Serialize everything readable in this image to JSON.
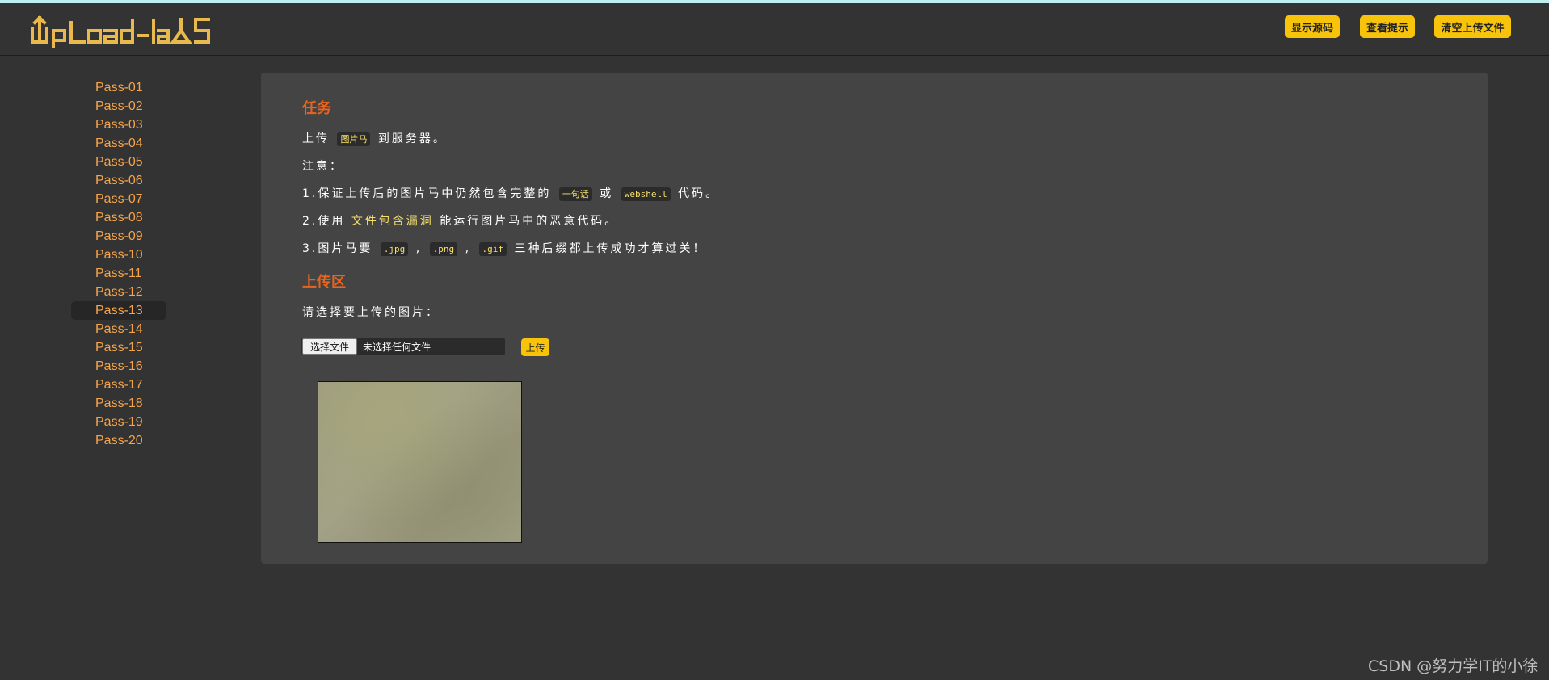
{
  "header": {
    "logo_text": "UpLoad-labS",
    "buttons": [
      "显示源码",
      "查看提示",
      "清空上传文件"
    ]
  },
  "sidebar": {
    "items": [
      "Pass-01",
      "Pass-02",
      "Pass-03",
      "Pass-04",
      "Pass-05",
      "Pass-06",
      "Pass-07",
      "Pass-08",
      "Pass-09",
      "Pass-10",
      "Pass-11",
      "Pass-12",
      "Pass-13",
      "Pass-14",
      "Pass-15",
      "Pass-16",
      "Pass-17",
      "Pass-18",
      "Pass-19",
      "Pass-20"
    ],
    "active": "Pass-13"
  },
  "task": {
    "title": "任务",
    "line1_pre": "上传",
    "line1_code": "图片马",
    "line1_post": "到服务器。",
    "note": "注意：",
    "item1_pre": "1.保证上传后的图片马中仍然包含完整的",
    "item1_code1": "一句话",
    "item1_mid": "或",
    "item1_code2": "webshell",
    "item1_post": "代码。",
    "item2_pre": "2.使用",
    "item2_hl": "文件包含漏洞",
    "item2_post": "能运行图片马中的恶意代码。",
    "item3_pre": "3.图片马要",
    "item3_code1": ".jpg",
    "item3_sep1": ",",
    "item3_code2": ".png",
    "item3_sep2": ",",
    "item3_code3": ".gif",
    "item3_post": "三种后缀都上传成功才算过关！"
  },
  "upload": {
    "title": "上传区",
    "prompt": "请选择要上传的图片：",
    "choose_label": "选择文件",
    "no_file_label": "未选择任何文件",
    "submit_label": "上传"
  },
  "watermark": "CSDN @努力学IT的小徐",
  "colors": {
    "accent": "#f7c40b",
    "nav_link": "#f6a54b",
    "title": "#e8641d"
  }
}
